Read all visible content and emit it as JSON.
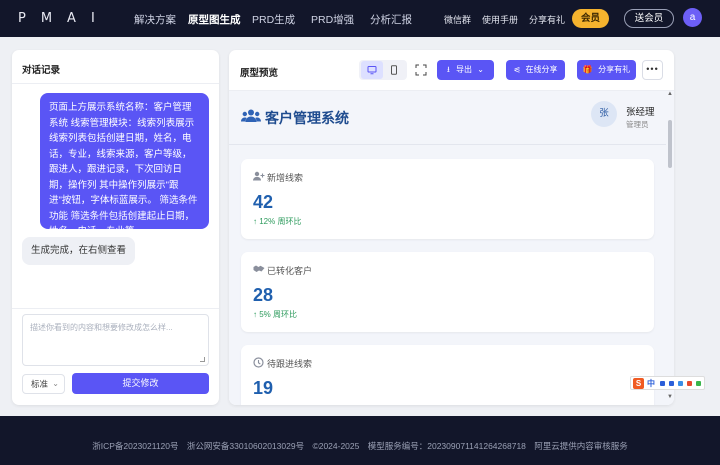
{
  "nav": {
    "logo": "PMAI",
    "items": [
      "解决方案",
      "原型图生成",
      "PRD生成",
      "PRD增强",
      "分析汇报"
    ],
    "active_index": 1,
    "right_links": [
      "微信群",
      "使用手册",
      "分享有礼"
    ],
    "vip_label": "会员",
    "gift_vip_label": "送会员",
    "avatar_letter": "a"
  },
  "chat": {
    "title": "对话记录",
    "user_message": "页面上方展示系统名称：客户管理系统 线索管理模块：线索列表展示线索列表包括创建日期，姓名，电话，专业，线索来源，客户等级，跟进人，跟进记录，下次回访日期，操作列 其中操作列展示\"跟进\"按钮，字体标蓝展示。 筛选条件功能 筛选条件包括创建起止日期，姓名，电话，专业等",
    "bot_message": "生成完成，在右侧查看",
    "input_placeholder": "描述你看到的内容和想要修改成怎么样...",
    "mode_select": "标准",
    "submit_label": "提交修改"
  },
  "preview": {
    "title": "原型预览",
    "icons": [
      "desktop-icon",
      "mobile-icon",
      "expand-icon"
    ],
    "export_label": "导出",
    "share_online_label": "在线分享",
    "share_gift_label": "分享有礼",
    "more_label": "•••",
    "system": {
      "name": "客户管理系统",
      "user_avatar": "张",
      "user_name": "张经理",
      "user_role": "管理员"
    },
    "cards": [
      {
        "label": "新增线索",
        "icon": "user-plus-icon",
        "value": "42",
        "trend": "12% 周环比"
      },
      {
        "label": "已转化客户",
        "icon": "handshake-icon",
        "value": "28",
        "trend": "5% 周环比"
      },
      {
        "label": "待跟进线索",
        "icon": "clock-icon",
        "value": "19",
        "trend": ""
      }
    ]
  },
  "ime": {
    "logo": "S",
    "label": "中"
  },
  "footer": {
    "items": [
      "浙ICP备2023021120号",
      "浙公网安备33010602013029号",
      "©2024-2025",
      "模型服务编号：20230907114126426871​8",
      "阿里云提供内容审核服务"
    ]
  },
  "colors": {
    "accent": "#5a55f5",
    "nav_bg": "#12162a",
    "vip": "#f5b32e",
    "metric_blue": "#1f5fae",
    "trend_green": "#2e9b5d"
  }
}
